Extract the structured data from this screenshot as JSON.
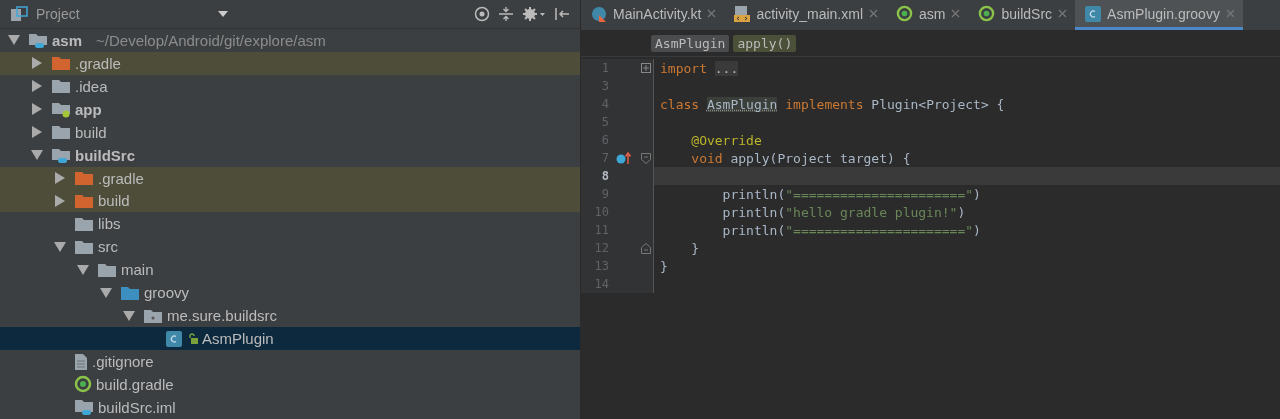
{
  "project_panel": {
    "title": "Project",
    "tree": [
      {
        "label": "asm",
        "kind": "module",
        "path": "~/Develop/Android/git/explore/asm",
        "expanded": true,
        "selected": false,
        "highlighted": false,
        "children": [
          {
            "label": ".gradle",
            "kind": "excluded-folder",
            "expanded": false,
            "selected": false,
            "highlighted": true
          },
          {
            "label": ".idea",
            "kind": "folder",
            "expanded": false,
            "selected": false,
            "highlighted": false
          },
          {
            "label": "app",
            "kind": "app-module",
            "expanded": false,
            "selected": false,
            "highlighted": false
          },
          {
            "label": "build",
            "kind": "folder",
            "expanded": false,
            "selected": false,
            "highlighted": false
          },
          {
            "label": "buildSrc",
            "kind": "module",
            "expanded": true,
            "selected": false,
            "highlighted": false,
            "children": [
              {
                "label": ".gradle",
                "kind": "excluded-folder",
                "expanded": false,
                "selected": false,
                "highlighted": true
              },
              {
                "label": "build",
                "kind": "excluded-folder",
                "expanded": false,
                "selected": false,
                "highlighted": true
              },
              {
                "label": "libs",
                "kind": "folder",
                "selected": false,
                "highlighted": false
              },
              {
                "label": "src",
                "kind": "folder",
                "expanded": true,
                "selected": false,
                "highlighted": false,
                "children": [
                  {
                    "label": "main",
                    "kind": "folder",
                    "expanded": true,
                    "selected": false,
                    "highlighted": false,
                    "children": [
                      {
                        "label": "groovy",
                        "kind": "source-folder",
                        "expanded": true,
                        "selected": false,
                        "highlighted": false,
                        "children": [
                          {
                            "label": "me.sure.buildsrc",
                            "kind": "package",
                            "expanded": true,
                            "selected": false,
                            "highlighted": false,
                            "children": [
                              {
                                "label": "AsmPlugin",
                                "kind": "class",
                                "selected": true,
                                "highlighted": false
                              }
                            ]
                          }
                        ]
                      }
                    ]
                  }
                ]
              },
              {
                "label": ".gitignore",
                "kind": "text-file",
                "selected": false,
                "highlighted": false
              },
              {
                "label": "build.gradle",
                "kind": "gradle-file",
                "selected": false,
                "highlighted": false
              },
              {
                "label": "buildSrc.iml",
                "kind": "iml-file",
                "selected": false,
                "highlighted": false
              }
            ]
          }
        ]
      }
    ]
  },
  "editor": {
    "tabs": [
      {
        "label": "MainActivity.kt",
        "kind": "kotlin",
        "selected": false
      },
      {
        "label": "activity_main.xml",
        "kind": "xml",
        "selected": false
      },
      {
        "label": "asm",
        "kind": "gradle",
        "selected": false
      },
      {
        "label": "buildSrc",
        "kind": "gradle",
        "selected": false
      },
      {
        "label": "AsmPlugin.groovy",
        "kind": "class",
        "selected": true
      }
    ],
    "breadcrumbs": [
      {
        "label": "AsmPlugin",
        "selected": false
      },
      {
        "label": "apply()",
        "selected": true
      }
    ],
    "lines": [
      {
        "number": "1",
        "fold": {
          "kind": "expand"
        },
        "current": false,
        "tokens": [
          {
            "kind": "keyword",
            "text": "import "
          },
          {
            "kind": "folded",
            "text": "..."
          }
        ]
      },
      {
        "number": "3",
        "current": false
      },
      {
        "number": "4",
        "current": false,
        "tokens": [
          {
            "kind": "keyword",
            "text": "class "
          },
          {
            "kind": "usage",
            "text": "AsmPlugin"
          },
          {
            "kind": "keyword",
            "text": " implements"
          },
          {
            "kind": "plain",
            "text": " Plugin<Project> {"
          }
        ]
      },
      {
        "number": "5",
        "current": false
      },
      {
        "number": "6",
        "current": false,
        "tokens": [
          {
            "kind": "annotation",
            "text": "    @Override"
          }
        ]
      },
      {
        "number": "7",
        "marker": {
          "kind": "override"
        },
        "fold": {
          "kind": "open"
        },
        "current": false,
        "tokens": [
          {
            "kind": "keyword",
            "text": "    void"
          },
          {
            "kind": "plain",
            "text": " apply(Project target) {"
          }
        ]
      },
      {
        "number": "8",
        "current": true
      },
      {
        "number": "9",
        "current": false,
        "tokens": [
          {
            "kind": "plain",
            "text": "        println("
          },
          {
            "kind": "string",
            "text": "\"======================\""
          },
          {
            "kind": "plain",
            "text": ")"
          }
        ]
      },
      {
        "number": "10",
        "current": false,
        "tokens": [
          {
            "kind": "plain",
            "text": "        println("
          },
          {
            "kind": "string",
            "text": "\"hello gradle plugin!\""
          },
          {
            "kind": "plain",
            "text": ")"
          }
        ]
      },
      {
        "number": "11",
        "current": false,
        "tokens": [
          {
            "kind": "plain",
            "text": "        println("
          },
          {
            "kind": "string",
            "text": "\"======================\""
          },
          {
            "kind": "plain",
            "text": ")"
          }
        ]
      },
      {
        "number": "12",
        "fold": {
          "kind": "close"
        },
        "current": false,
        "tokens": [
          {
            "kind": "plain",
            "text": "    }"
          }
        ]
      },
      {
        "number": "13",
        "current": false,
        "tokens": [
          {
            "kind": "plain",
            "text": "}"
          }
        ]
      },
      {
        "number": "14",
        "current": false
      }
    ]
  }
}
